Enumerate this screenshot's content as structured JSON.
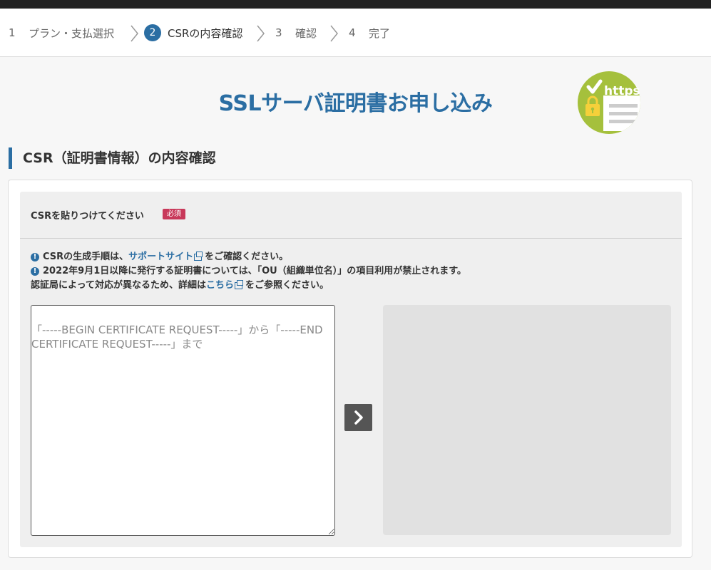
{
  "stepper": {
    "steps": [
      {
        "num": "1",
        "label": "プラン・支払選択"
      },
      {
        "num": "2",
        "label": "CSRの内容確認"
      },
      {
        "num": "3",
        "label": "確認"
      },
      {
        "num": "4",
        "label": "完了"
      }
    ]
  },
  "page": {
    "title": "SSLサーバ証明書お申し込み",
    "logo_text": "https"
  },
  "section": {
    "heading": "CSR（証明書情報）の内容確認"
  },
  "form": {
    "csr_label": "CSRを貼りつけてください",
    "required_badge": "必須",
    "note1_prefix": "CSRの生成手順は、",
    "note1_link": "サポートサイト",
    "note1_suffix": "をご確認ください。",
    "note2": "2022年9月1日以降に発行する証明書については、「OU（組織単位名）」の項目利用が禁止されます。",
    "note3_prefix": "認証局によって対応が異なるため、詳細は",
    "note3_link": "こちら",
    "note3_suffix": "をご参照ください。",
    "csr_placeholder": "「-----BEGIN CERTIFICATE REQUEST-----」から「-----END CERTIFICATE REQUEST-----」まで",
    "csr_value": ""
  },
  "colors": {
    "accent": "#2b6ea3",
    "required": "#c8385a",
    "logo_green": "#a5c03c"
  }
}
